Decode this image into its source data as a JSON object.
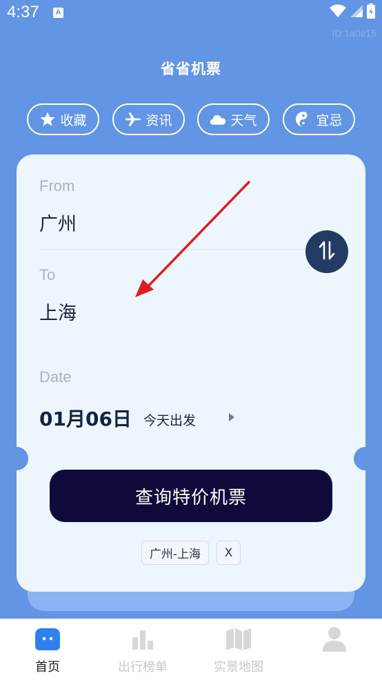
{
  "status_bar": {
    "time": "4:37",
    "notification_badge": "A",
    "icons": [
      "wifi-icon",
      "signal-icon",
      "battery-icon"
    ],
    "id_text": "ID:1a0e15"
  },
  "app": {
    "title": "省省机票"
  },
  "quick_actions": [
    {
      "label": "收藏",
      "icon": "star-icon"
    },
    {
      "label": "资讯",
      "icon": "airplane-icon"
    },
    {
      "label": "天气",
      "icon": "cloud-icon"
    },
    {
      "label": "宜忌",
      "icon": "yin-yang-icon"
    }
  ],
  "search_form": {
    "from_label": "From",
    "from_value": "广州",
    "to_label": "To",
    "to_value": "上海",
    "date_label": "Date",
    "date_value": "01月06日",
    "date_sub": "今天出发",
    "search_button": "查询特价机票",
    "history_chip": "广州-上海",
    "clear_history": "X"
  },
  "bottom_nav": {
    "items": [
      {
        "label": "首页",
        "icon": "home-icon",
        "active": true
      },
      {
        "label": "出行榜单",
        "icon": "bar-chart-icon",
        "active": false
      },
      {
        "label": "实景地图",
        "icon": "map-icon",
        "active": false
      },
      {
        "label": "",
        "icon": "user-icon",
        "active": false
      }
    ]
  },
  "colors": {
    "background": "#6295E3",
    "card": "#EDF5FD",
    "primary_dark": "#0E0B3A",
    "swap_button": "#233A63",
    "annotation_arrow": "#D91F1F"
  }
}
